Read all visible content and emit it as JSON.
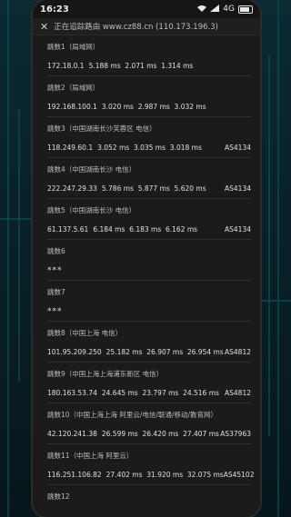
{
  "status": {
    "time": "16:23",
    "network": "4G",
    "battery_level": 0.7
  },
  "nav": {
    "url_text": "正在追踪路由 www.cz88.cn (110.173.196.3)"
  },
  "hops": [
    {
      "title": "跳数1（局域网）",
      "ip": "172.18.0.1",
      "times": "5.188 ms  2.071 ms  1.314 ms",
      "as": ""
    },
    {
      "title": "跳数2（局域网）",
      "ip": "192.168.100.1",
      "times": "3.020 ms  2.987 ms  3.032 ms",
      "as": ""
    },
    {
      "title": "跳数3（中国湖南长沙芙蓉区 电信）",
      "ip": "118.249.60.1",
      "times": "3.052 ms  3.035 ms  3.018 ms",
      "as": "AS4134"
    },
    {
      "title": "跳数4（中国湖南长沙 电信）",
      "ip": "222.247.29.33",
      "times": "5.786 ms  5.877 ms  5.620 ms",
      "as": "AS4134"
    },
    {
      "title": "跳数5（中国湖南长沙 电信）",
      "ip": "61.137.5.61",
      "times": "6.184 ms  6.183 ms  6.162 ms",
      "as": "AS4134"
    },
    {
      "title": "跳数6",
      "ip": "***",
      "times": "",
      "as": ""
    },
    {
      "title": "跳数7",
      "ip": "***",
      "times": "",
      "as": ""
    },
    {
      "title": "跳数8（中国上海 电信）",
      "ip": "101.95.209.250",
      "times": "25.182 ms  26.907 ms  26.954 ms",
      "as": "AS4812"
    },
    {
      "title": "跳数9（中国上海上海浦东新区 电信）",
      "ip": "180.163.53.74",
      "times": "24.645 ms  23.797 ms  24.516 ms",
      "as": "AS4812"
    },
    {
      "title": "跳数10（中国上海上海 阿里云/电信/联通/移动/教育网）",
      "ip": "42.120.241.38",
      "times": "26.599 ms  26.420 ms  27.407 ms",
      "as": "AS37963"
    },
    {
      "title": "跳数11（中国上海 阿里云）",
      "ip": "116.251.106.82",
      "times": "27.402 ms  31.920 ms  32.075 ms",
      "as": "AS45102"
    },
    {
      "title": "跳数12",
      "ip": "",
      "times": "",
      "as": ""
    }
  ]
}
